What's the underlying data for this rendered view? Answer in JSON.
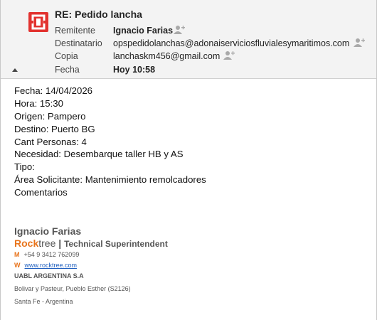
{
  "message": {
    "subject": "RE: Pedido lancha",
    "fields": [
      {
        "label": "Remitente",
        "value": "Ignacio Farias",
        "bold": true,
        "has_contact_icon": true
      },
      {
        "label": "Destinatario",
        "value": "opspedidolanchas@adonaiserviciosfluvialesymaritimos.com",
        "bold": false,
        "has_contact_icon": true
      },
      {
        "label": "Copia",
        "value": "lanchaskm456@gmail.com",
        "bold": false,
        "has_contact_icon": true
      },
      {
        "label": "Fecha",
        "value": "Hoy 10:58",
        "bold": true,
        "has_contact_icon": false
      }
    ],
    "icons": {
      "app": "office-logo-icon",
      "contact": "add-contact-icon",
      "collapse": "collapse-arrow-icon"
    },
    "colors": {
      "logo": "#e2322f",
      "header_bg": "#f3f3f3",
      "brand_orange": "#e8741c",
      "link": "#1f5fbf"
    }
  },
  "body": {
    "lines": [
      "Fecha: 14/04/2026",
      "Hora: 15:30",
      "Origen: Pampero",
      "Destino: Puerto BG",
      "Cant Personas: 4",
      "Necesidad: Desembarque taller HB y AS",
      "Tipo:",
      "Área Solicitante: Mantenimiento remolcadores",
      "Comentarios"
    ]
  },
  "signature": {
    "name": "Ignacio Farias",
    "brand_bold": "Rock",
    "brand_rest": "tree",
    "separator": "|",
    "role": "Technical Superintendent",
    "mobile_key": "M",
    "mobile": "+54 9 3412 762099",
    "web_key": "W",
    "web": "www.rocktree.com",
    "company": "UABL ARGENTINA S.A",
    "address1": "Bolivar y Pasteur, Pueblo Esther (S2126)",
    "address2": "Santa Fe - Argentina"
  }
}
